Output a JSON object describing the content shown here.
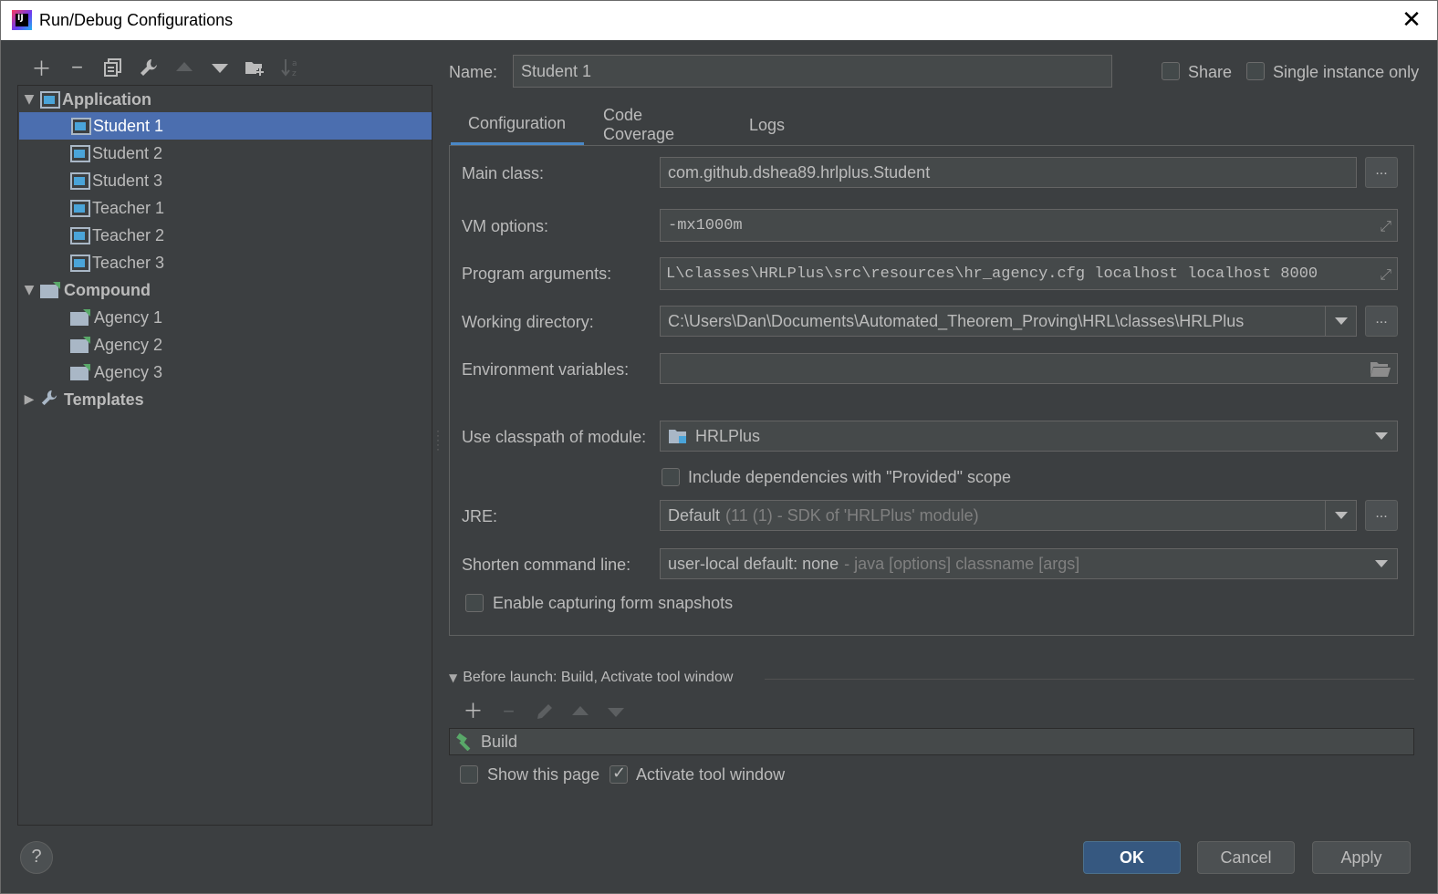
{
  "window": {
    "title": "Run/Debug Configurations",
    "close_glyph": "✕"
  },
  "toolbar": {
    "icons": [
      "add-icon",
      "remove-icon",
      "copy-icon",
      "wrench-icon",
      "move-up-icon",
      "move-down-icon",
      "new-folder-icon",
      "sort-icon"
    ]
  },
  "tree": {
    "application": {
      "label": "Application",
      "items": [
        "Student 1",
        "Student 2",
        "Student 3",
        "Teacher 1",
        "Teacher 2",
        "Teacher 3"
      ]
    },
    "compound": {
      "label": "Compound",
      "items": [
        "Agency 1",
        "Agency 2",
        "Agency 3"
      ]
    },
    "templates": {
      "label": "Templates"
    },
    "selected": "Student 1"
  },
  "header": {
    "name_label": "Name:",
    "name_value": "Student 1",
    "share_label": "Share",
    "single_instance_label": "Single instance only"
  },
  "tabs": [
    "Configuration",
    "Code Coverage",
    "Logs"
  ],
  "active_tab": "Configuration",
  "config": {
    "main_class_label": "Main class:",
    "main_class_value": "com.github.dshea89.hrlplus.Student",
    "vm_options_label": "VM options:",
    "vm_options_value": "-mx1000m",
    "program_args_label": "Program arguments:",
    "program_args_value": "L\\classes\\HRLPlus\\src\\resources\\hr_agency.cfg localhost localhost 8000",
    "working_dir_label": "Working directory:",
    "working_dir_value": "C:\\Users\\Dan\\Documents\\Automated_Theorem_Proving\\HRL\\classes\\HRLPlus",
    "env_vars_label": "Environment variables:",
    "env_vars_value": "",
    "classpath_label": "Use classpath of module:",
    "classpath_value": "HRLPlus",
    "include_deps_label": "Include dependencies with \"Provided\" scope",
    "jre_label": "JRE:",
    "jre_value": "Default",
    "jre_detail": "(11 (1) - SDK of 'HRLPlus' module)",
    "shorten_label": "Shorten command line:",
    "shorten_value": "user-local default: none",
    "shorten_detail": "- java [options] classname [args]",
    "snapshots_label": "Enable capturing form snapshots"
  },
  "before_launch": {
    "header": "Before launch: Build, Activate tool window",
    "items": [
      "Build"
    ],
    "show_page_label": "Show this page",
    "activate_label": "Activate tool window",
    "activate_checked": true
  },
  "buttons": {
    "ok": "OK",
    "cancel": "Cancel",
    "apply": "Apply",
    "help": "?"
  },
  "colors": {
    "selection": "#4b6eaf",
    "primary_button": "#365880",
    "tab_underline": "#4a88c7",
    "background": "#3c3f41"
  }
}
